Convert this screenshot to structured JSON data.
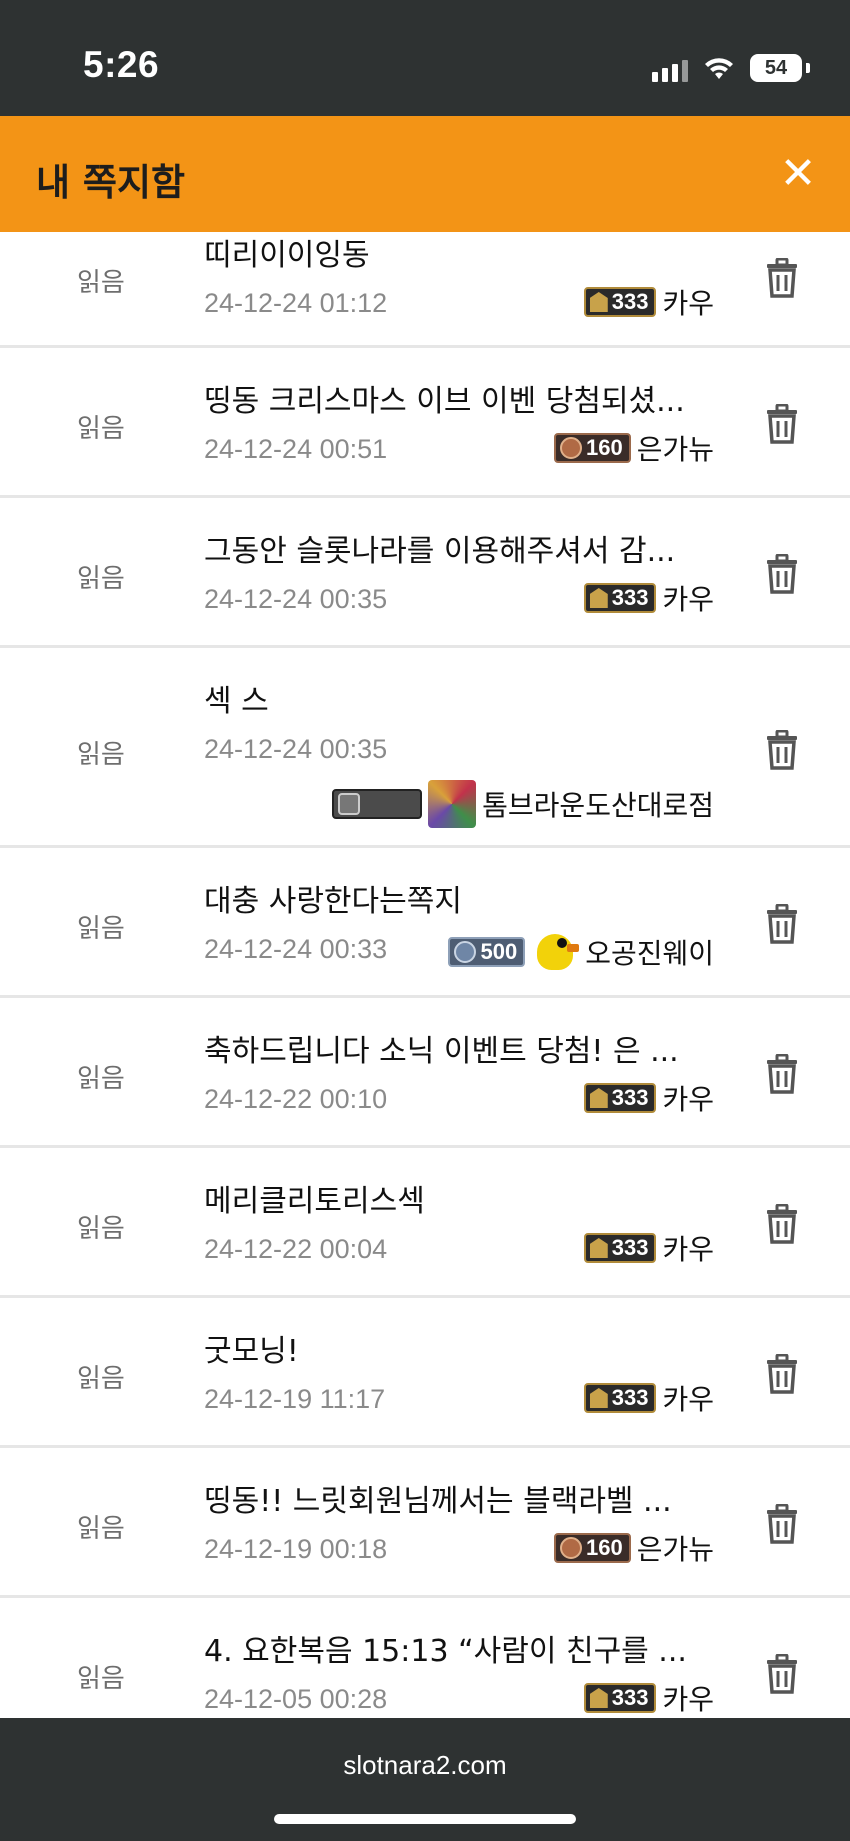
{
  "status": {
    "time": "5:26",
    "battery": "54"
  },
  "header": {
    "title": "내 쪽지함",
    "close_icon": "close-icon"
  },
  "read_label": "읽음",
  "messages": [
    {
      "subject": "띠리이이잉동",
      "date": "24-12-24 01:12",
      "sender": "카우",
      "badge": "333",
      "badge_style": "gold"
    },
    {
      "subject": "띵동 크리스마스 이브 이벤 당첨되셨...",
      "date": "24-12-24 00:51",
      "sender": "은가뉴",
      "badge": "160",
      "badge_style": "bronze"
    },
    {
      "subject": "그동안 슬롯나라를 이용해주셔서 감...",
      "date": "24-12-24 00:35",
      "sender": "카우",
      "badge": "333",
      "badge_style": "gold"
    },
    {
      "subject": "섹 스",
      "date": "24-12-24 00:35",
      "sender": "톰브라운도산대로점",
      "badge": "",
      "badge_style": "gray",
      "avatar": "mosaic"
    },
    {
      "subject": "대충 사랑한다는쪽지",
      "date": "24-12-24 00:33",
      "sender": "오공진웨이",
      "badge": "500",
      "badge_style": "blue",
      "avatar": "bird"
    },
    {
      "subject": "축하드립니다 소닉 이벤트 당첨! 은 ...",
      "date": "24-12-22 00:10",
      "sender": "카우",
      "badge": "333",
      "badge_style": "gold"
    },
    {
      "subject": "메리클리토리스섹",
      "date": "24-12-22 00:04",
      "sender": "카우",
      "badge": "333",
      "badge_style": "gold"
    },
    {
      "subject": "굿모닝!",
      "date": "24-12-19 11:17",
      "sender": "카우",
      "badge": "333",
      "badge_style": "gold"
    },
    {
      "subject": "띵동!! 느릿회원님께서는 블랙라벨 ...",
      "date": "24-12-19 00:18",
      "sender": "은가뉴",
      "badge": "160",
      "badge_style": "bronze"
    },
    {
      "subject": "4. 요한복음 15:13 “사람이 친구를 ...",
      "date": "24-12-05 00:28",
      "sender": "카우",
      "badge": "333",
      "badge_style": "gold"
    }
  ],
  "footer": {
    "url": "slotnara2.com"
  },
  "icons": {
    "delete": "trash-icon"
  }
}
